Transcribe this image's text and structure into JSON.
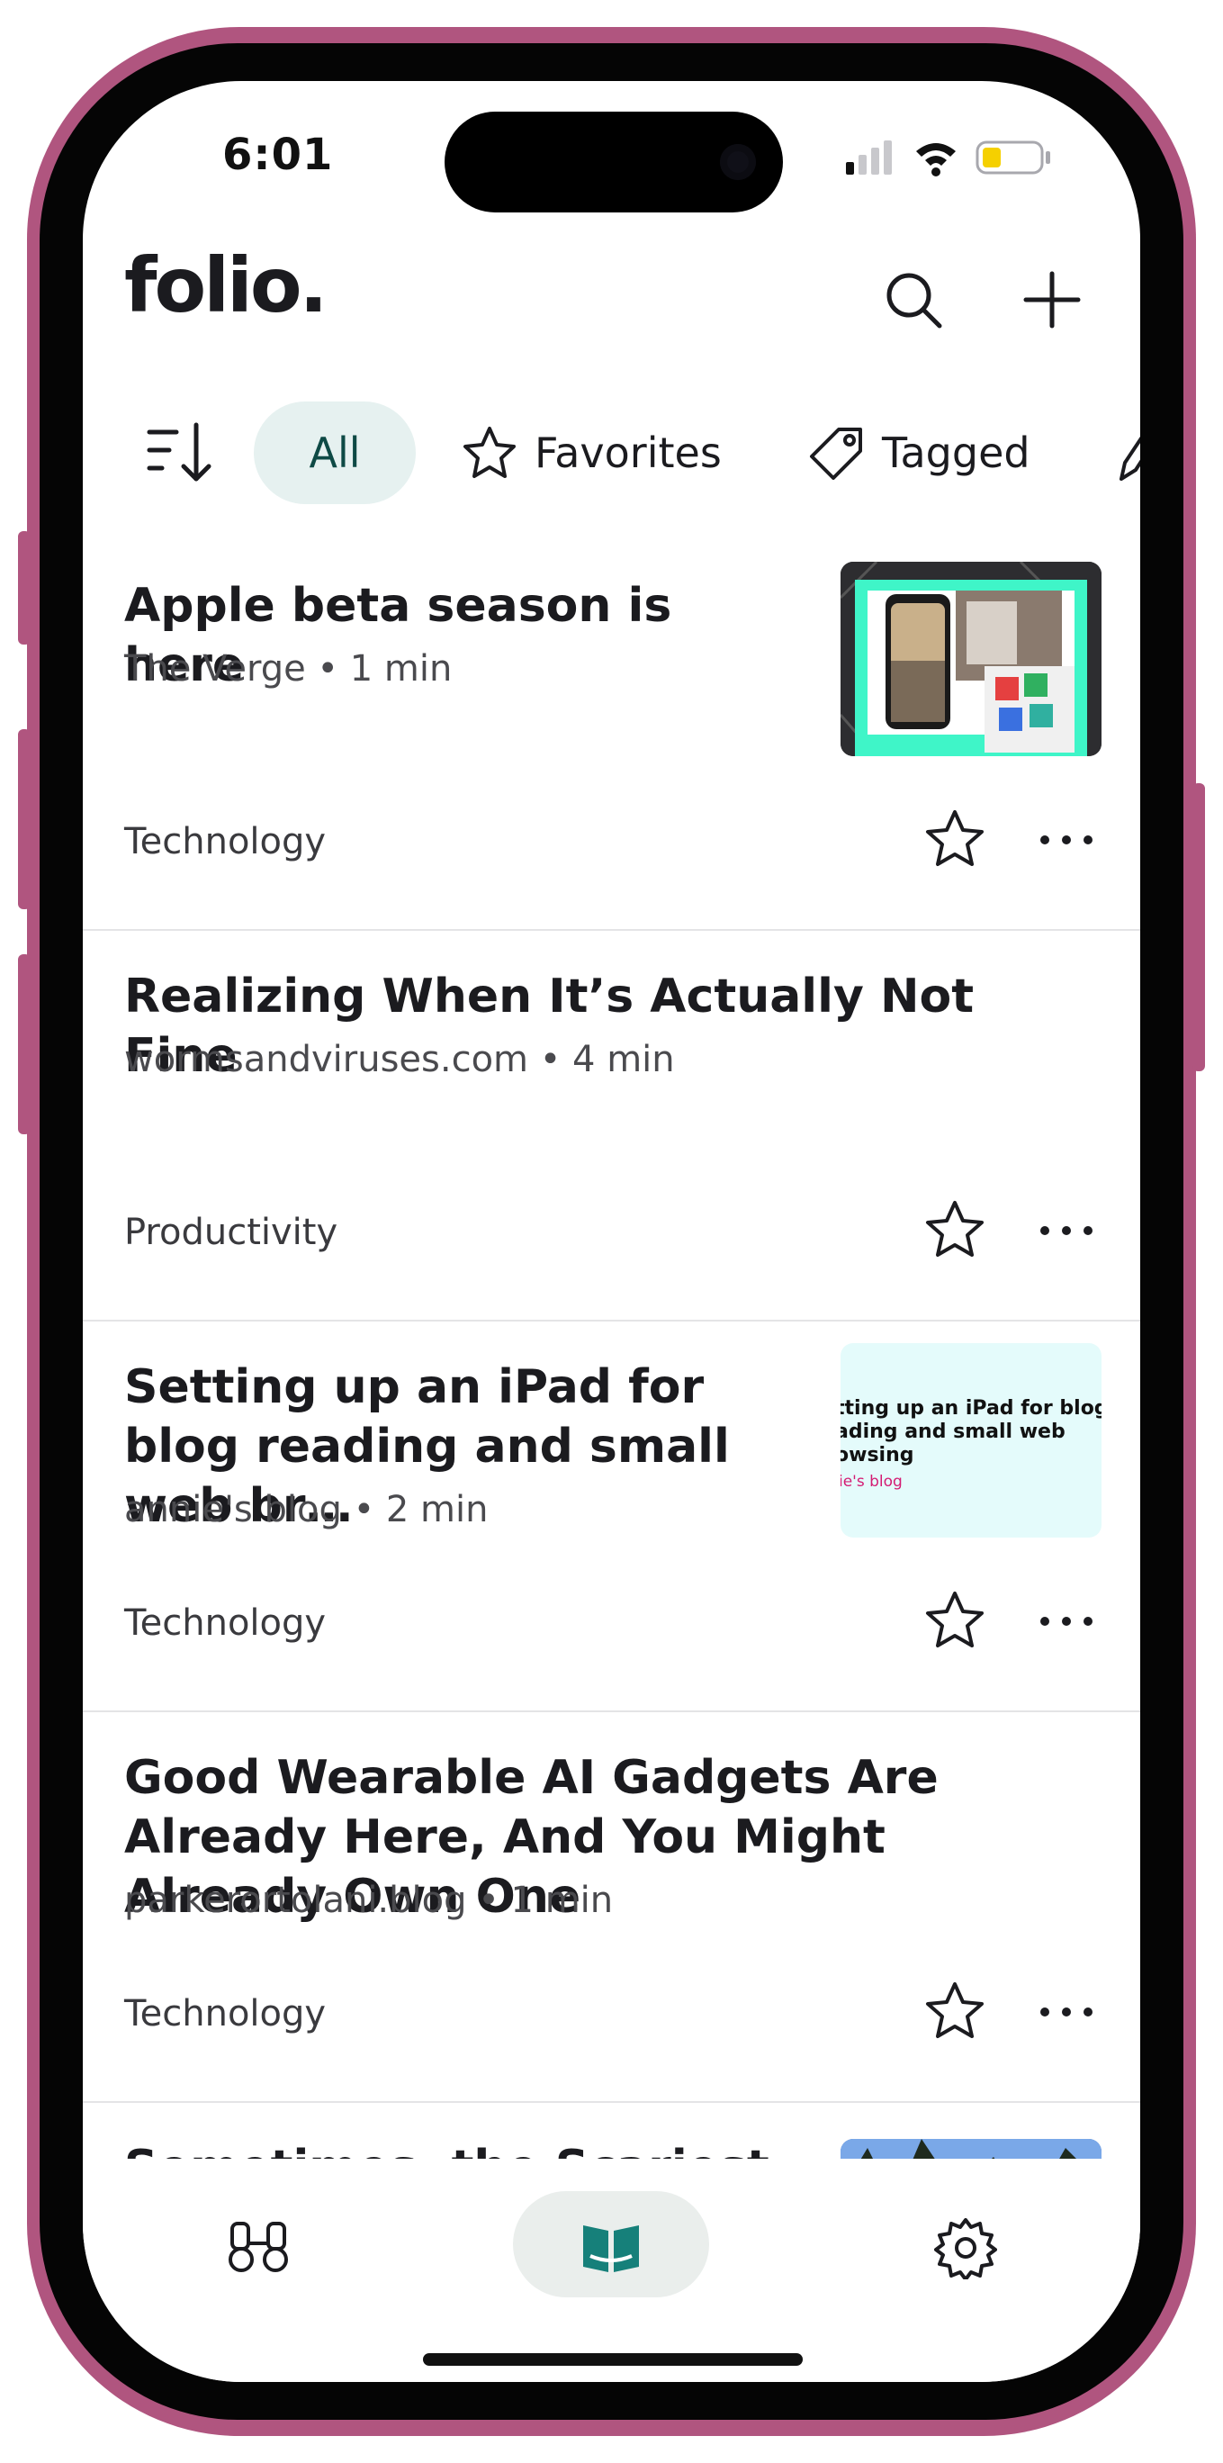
{
  "status": {
    "time": "6:01"
  },
  "app": {
    "logo": "folio."
  },
  "header": {
    "search_icon": "search-icon",
    "add_icon": "plus-icon"
  },
  "filters": {
    "sort_icon": "sort-icon",
    "chips": [
      {
        "label": "All",
        "active": true
      },
      {
        "label": "Favorites",
        "icon": "star-icon"
      },
      {
        "label": "Tagged",
        "icon": "tag-icon"
      }
    ]
  },
  "articles": [
    {
      "title": "Apple beta season is here",
      "meta": "The Verge • 1 min",
      "tag": "Technology",
      "thumbnail": "phones-collage"
    },
    {
      "title": "Realizing When It’s Actually Not Fine",
      "meta": "wormsandviruses.com • 4 min",
      "tag": "Productivity"
    },
    {
      "title": "Setting up an iPad for blog reading and small web br…",
      "meta": "annie's blog • 2 min",
      "tag": "Technology",
      "thumb_text": "tting up an iPad for blog\nading and small web\nowsing",
      "thumb_sub": "ie's blog"
    },
    {
      "title": "Good Wearable AI Gadgets Are Already Here, And You Might Already Own One",
      "meta": "parkerortolani.blog • 1 min",
      "tag": "Technology"
    },
    {
      "title": "Sometimes, the Scariest"
    }
  ],
  "tabbar": {
    "items": [
      "binoculars-icon",
      "book-icon",
      "gear-icon"
    ],
    "active": "book-icon"
  },
  "colors": {
    "accent": "#16807a",
    "chip_bg": "#e6f1f0",
    "frame": "#b0557f"
  }
}
